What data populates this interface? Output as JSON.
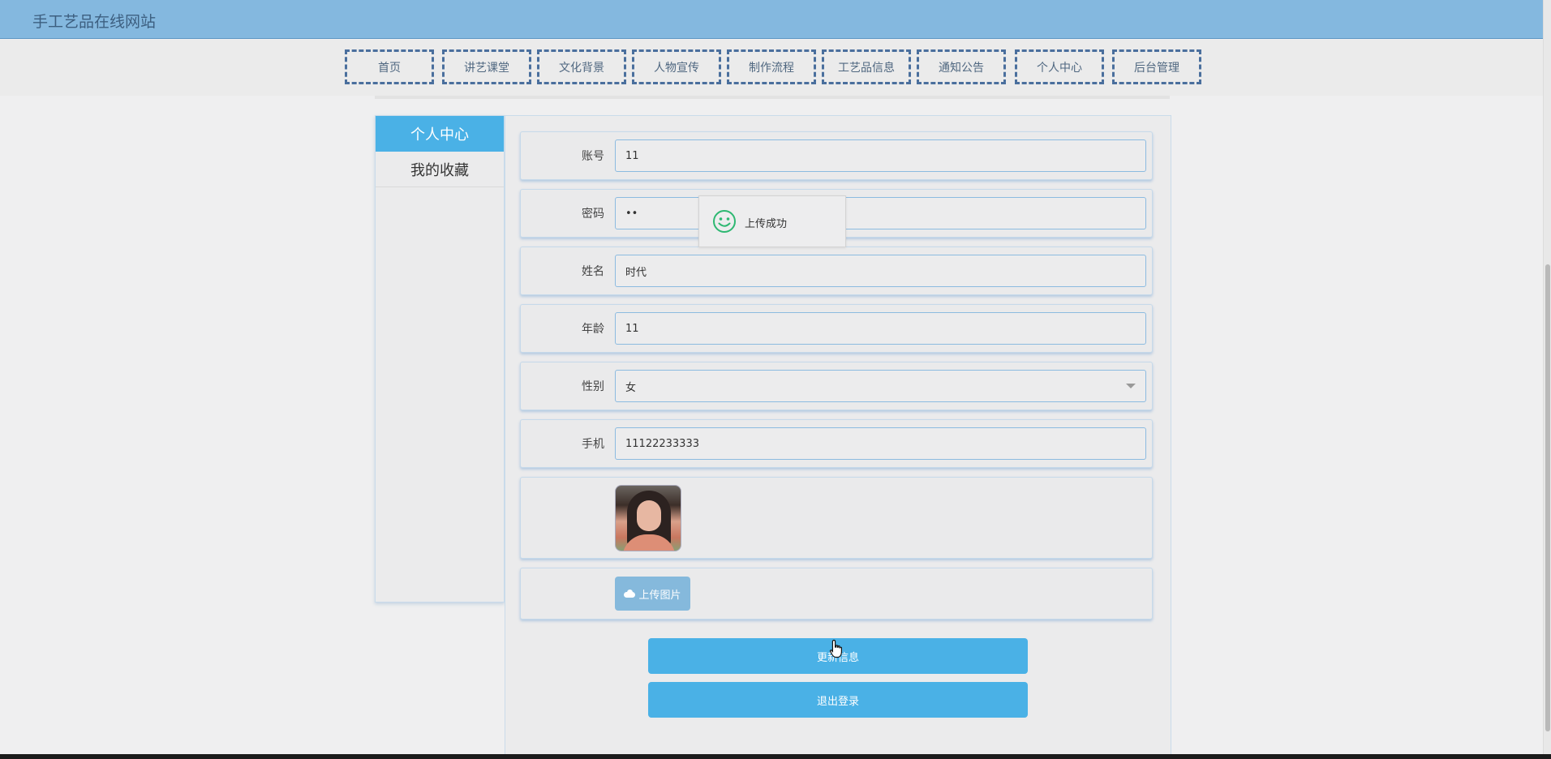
{
  "header": {
    "title": "手工艺品在线网站"
  },
  "nav": {
    "items": [
      {
        "label": "首页"
      },
      {
        "label": "讲艺课堂"
      },
      {
        "label": "文化背景"
      },
      {
        "label": "人物宣传"
      },
      {
        "label": "制作流程"
      },
      {
        "label": "工艺品信息"
      },
      {
        "label": "通知公告"
      },
      {
        "label": "个人中心"
      },
      {
        "label": "后台管理"
      }
    ]
  },
  "sidebar": {
    "items": [
      {
        "label": "个人中心",
        "active": true
      },
      {
        "label": "我的收藏",
        "active": false
      }
    ]
  },
  "form": {
    "account": {
      "label": "账号",
      "value": "11"
    },
    "password": {
      "label": "密码",
      "value": "••"
    },
    "name": {
      "label": "姓名",
      "value": "时代"
    },
    "age": {
      "label": "年龄",
      "value": "11"
    },
    "gender": {
      "label": "性别",
      "value": "女"
    },
    "phone": {
      "label": "手机",
      "value": "11122233333"
    },
    "upload_label": "上传图片",
    "update_button": "更新信息",
    "logout_button": "退出登录"
  },
  "toast": {
    "message": "上传成功",
    "icon": "smile-icon"
  },
  "colors": {
    "header": "#84b8df",
    "nav_border": "#4a6f9d",
    "accent": "#4ab1e6",
    "toast_icon": "#2eb872"
  }
}
